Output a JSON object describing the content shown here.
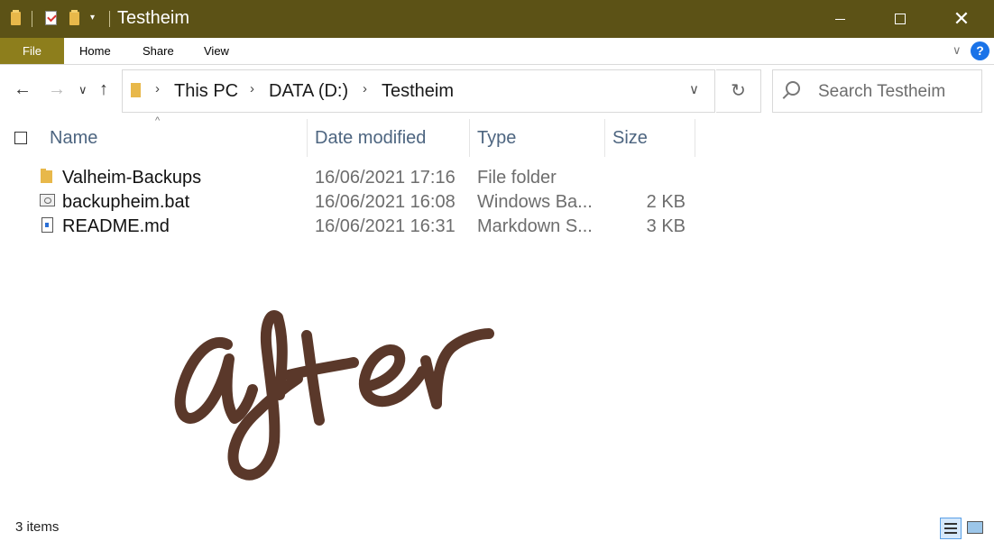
{
  "window": {
    "title": "Testheim",
    "qa_dropdown": "▾"
  },
  "window_controls": {
    "minimize": "",
    "maximize": "",
    "close": "✕"
  },
  "ribbon": {
    "tabs": [
      "File",
      "Home",
      "Share",
      "View"
    ],
    "chevron": "∨",
    "help": "?"
  },
  "nav": {
    "back": "←",
    "forward": "→",
    "recent": "∨",
    "up": "↑"
  },
  "address": {
    "crumbs": [
      "This PC",
      "DATA (D:)",
      "Testheim"
    ],
    "sep": "›",
    "dropdown": "∨",
    "refresh": "↻"
  },
  "search": {
    "placeholder": "Search Testheim"
  },
  "columns": [
    "Name",
    "Date modified",
    "Type",
    "Size"
  ],
  "sort_indicator": "^",
  "files": [
    {
      "icon": "folder-icon",
      "name": "Valheim-Backups",
      "date": "16/06/2021 17:16",
      "type": "File folder",
      "size": ""
    },
    {
      "icon": "batch-file-icon",
      "name": "backupheim.bat",
      "date": "16/06/2021 16:08",
      "type": "Windows Ba...",
      "size": "2 KB"
    },
    {
      "icon": "markdown-file-icon",
      "name": "README.md",
      "date": "16/06/2021 16:31",
      "type": "Markdown S...",
      "size": "3 KB"
    }
  ],
  "status": {
    "items": "3 items"
  },
  "colors": {
    "titlebar": "#5c5216",
    "file_tab": "#8d7e1c",
    "handwriting": "#5a382a",
    "column_header": "#4d6580"
  }
}
